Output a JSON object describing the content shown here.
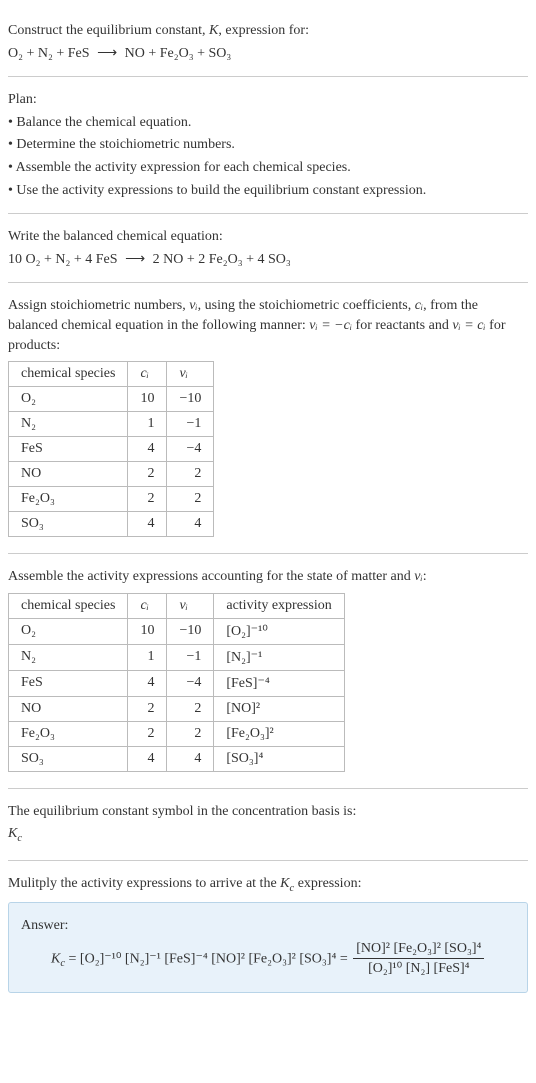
{
  "intro": {
    "line1_pre": "Construct the equilibrium constant, ",
    "line1_k": "K",
    "line1_post": ", expression for:",
    "eq_lhs": "O₂ + N₂ + FeS",
    "arrow": "⟶",
    "eq_rhs": "NO + Fe₂O₃ + SO₃"
  },
  "plan": {
    "title": "Plan:",
    "b1": "• Balance the chemical equation.",
    "b2": "• Determine the stoichiometric numbers.",
    "b3": "• Assemble the activity expression for each chemical species.",
    "b4": "• Use the activity expressions to build the equilibrium constant expression."
  },
  "balanced": {
    "title": "Write the balanced chemical equation:",
    "eq_lhs": "10 O₂ + N₂ + 4 FeS",
    "arrow": "⟶",
    "eq_rhs": "2 NO + 2 Fe₂O₃ + 4 SO₃"
  },
  "stoich": {
    "intro_a": "Assign stoichiometric numbers, ",
    "nu_i": "νᵢ",
    "intro_b": ", using the stoichiometric coefficients, ",
    "c_i": "cᵢ",
    "intro_c": ", from the balanced chemical equation in the following manner: ",
    "rule1": "νᵢ = −cᵢ",
    "intro_d": " for reactants and ",
    "rule2": "νᵢ = cᵢ",
    "intro_e": " for products:",
    "h1": "chemical species",
    "h2": "cᵢ",
    "h3": "νᵢ",
    "rows": [
      {
        "sp": "O₂",
        "c": "10",
        "v": "−10"
      },
      {
        "sp": "N₂",
        "c": "1",
        "v": "−1"
      },
      {
        "sp": "FeS",
        "c": "4",
        "v": "−4"
      },
      {
        "sp": "NO",
        "c": "2",
        "v": "2"
      },
      {
        "sp": "Fe₂O₃",
        "c": "2",
        "v": "2"
      },
      {
        "sp": "SO₃",
        "c": "4",
        "v": "4"
      }
    ]
  },
  "activity": {
    "intro_a": "Assemble the activity expressions accounting for the state of matter and ",
    "nu_i": "νᵢ",
    "intro_b": ":",
    "h1": "chemical species",
    "h2": "cᵢ",
    "h3": "νᵢ",
    "h4": "activity expression",
    "rows": [
      {
        "sp": "O₂",
        "c": "10",
        "v": "−10",
        "a": "[O₂]⁻¹⁰"
      },
      {
        "sp": "N₂",
        "c": "1",
        "v": "−1",
        "a": "[N₂]⁻¹"
      },
      {
        "sp": "FeS",
        "c": "4",
        "v": "−4",
        "a": "[FeS]⁻⁴"
      },
      {
        "sp": "NO",
        "c": "2",
        "v": "2",
        "a": "[NO]²"
      },
      {
        "sp": "Fe₂O₃",
        "c": "2",
        "v": "2",
        "a": "[Fe₂O₃]²"
      },
      {
        "sp": "SO₃",
        "c": "4",
        "v": "4",
        "a": "[SO₃]⁴"
      }
    ]
  },
  "symbol": {
    "title": "The equilibrium constant symbol in the concentration basis is:",
    "kc": "K_c"
  },
  "final": {
    "title_a": "Mulitply the activity expressions to arrive at the ",
    "kc": "K_c",
    "title_b": " expression:",
    "answer_label": "Answer:",
    "kc_eq": "K_c",
    "equals": " = ",
    "prod": "[O₂]⁻¹⁰ [N₂]⁻¹ [FeS]⁻⁴ [NO]² [Fe₂O₃]² [SO₃]⁴",
    "frac_num": "[NO]² [Fe₂O₃]² [SO₃]⁴",
    "frac_den": "[O₂]¹⁰ [N₂] [FeS]⁴"
  }
}
